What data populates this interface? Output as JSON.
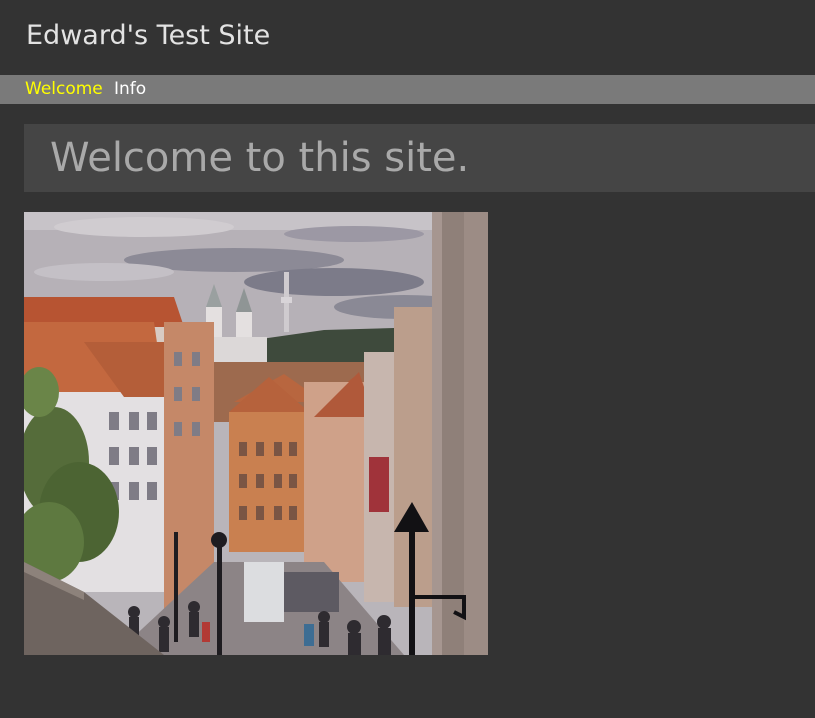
{
  "header": {
    "site_title": "Edward's Test Site"
  },
  "nav": {
    "items": [
      {
        "label": "Welcome",
        "active": true
      },
      {
        "label": "Info",
        "active": false
      }
    ],
    "active_color": "#ffff00",
    "inactive_color": "#ffffff"
  },
  "main": {
    "heading": "Welcome to this site."
  },
  "colors": {
    "page_background": "#333333",
    "nav_background": "#7a7a7a",
    "banner_background": "#454545"
  }
}
